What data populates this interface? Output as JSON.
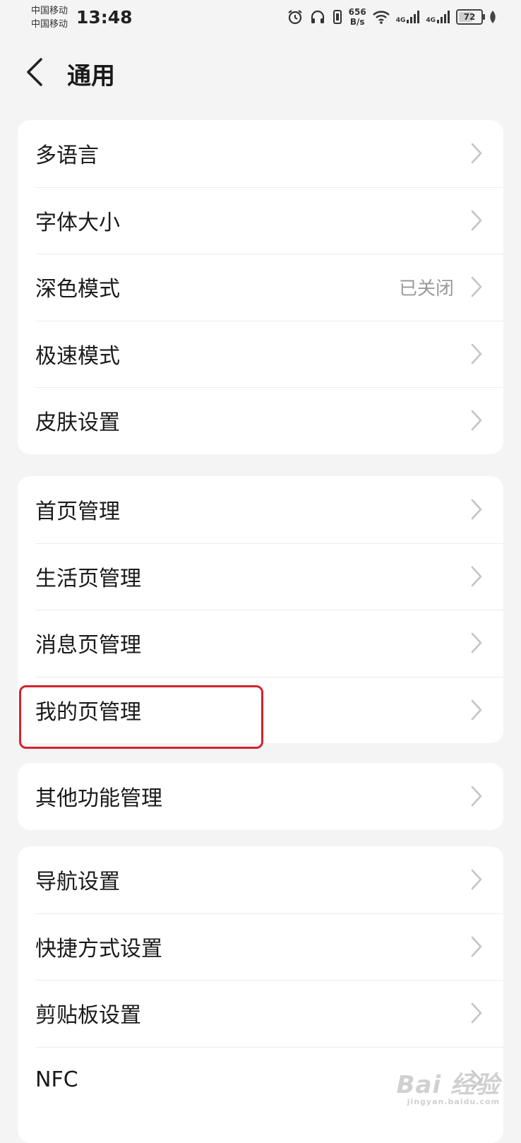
{
  "status_bar": {
    "carrier1": "中国移动",
    "carrier2": "中国移动",
    "time": "13:48",
    "net_speed_value": "656",
    "net_speed_unit": "B/s",
    "sig1_label": "4G",
    "sig2_label": "4G",
    "battery": "72",
    "battery_level": 0.72
  },
  "header": {
    "title": "通用"
  },
  "groups": [
    {
      "items": [
        {
          "label": "多语言",
          "value": ""
        },
        {
          "label": "字体大小",
          "value": ""
        },
        {
          "label": "深色模式",
          "value": "已关闭"
        },
        {
          "label": "极速模式",
          "value": ""
        },
        {
          "label": "皮肤设置",
          "value": ""
        }
      ]
    },
    {
      "items": [
        {
          "label": "首页管理",
          "value": ""
        },
        {
          "label": "生活页管理",
          "value": ""
        },
        {
          "label": "消息页管理",
          "value": ""
        },
        {
          "label": "我的页管理",
          "value": ""
        }
      ]
    },
    {
      "items": [
        {
          "label": "其他功能管理",
          "value": ""
        }
      ]
    },
    {
      "items": [
        {
          "label": "导航设置",
          "value": ""
        },
        {
          "label": "快捷方式设置",
          "value": ""
        },
        {
          "label": "剪贴板设置",
          "value": ""
        },
        {
          "label": "NFC",
          "value": ""
        }
      ]
    }
  ],
  "watermark": {
    "text": "Bai 经验",
    "sub": "jingyan.baidu.com"
  },
  "colors": {
    "background": "#f4f4f4",
    "card": "#ffffff",
    "highlight": "#d3232e"
  }
}
